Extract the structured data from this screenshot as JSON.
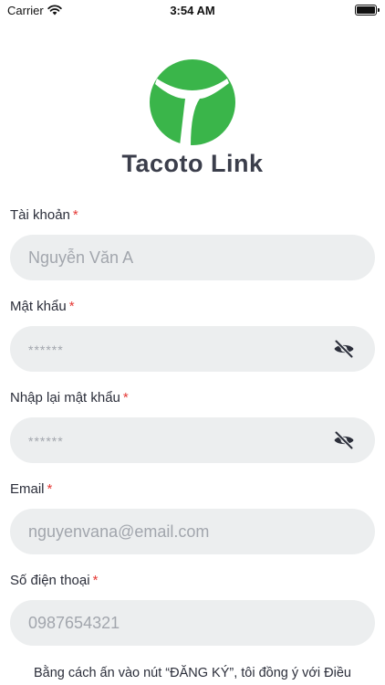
{
  "status": {
    "carrier": "Carrier",
    "time": "3:54 AM"
  },
  "brand": {
    "name": "Tacoto Link",
    "accent": "#3ab54a"
  },
  "form": {
    "account": {
      "label": "Tài khoản",
      "required": "*",
      "placeholder": "Nguyễn Văn A"
    },
    "password": {
      "label": "Mật khẩu",
      "required": "*",
      "placeholder": "******",
      "icon": "eye-off-icon"
    },
    "confirm_password": {
      "label": "Nhập lại mật khẩu",
      "required": "*",
      "placeholder": "******",
      "icon": "eye-off-icon"
    },
    "email": {
      "label": "Email",
      "required": "*",
      "placeholder": "nguyenvana@email.com"
    },
    "phone": {
      "label": "Số điện thoại",
      "required": "*",
      "placeholder": "0987654321"
    }
  },
  "terms": {
    "text": "Bằng cách ấn vào nút “ĐĂNG KÝ”, tôi đồng ý với Điều"
  }
}
